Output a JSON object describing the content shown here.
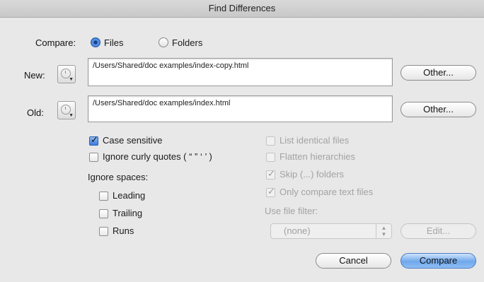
{
  "window": {
    "title": "Find Differences"
  },
  "compare": {
    "label": "Compare:",
    "options": [
      {
        "label": "Files",
        "selected": true
      },
      {
        "label": "Folders",
        "selected": false
      }
    ]
  },
  "new_file": {
    "label": "New:",
    "path": "/Users/Shared/doc examples/index-copy.html",
    "other_label": "Other..."
  },
  "old_file": {
    "label": "Old:",
    "path": "/Users/Shared/doc examples/index.html",
    "other_label": "Other..."
  },
  "options_left": {
    "case_sensitive": {
      "label": "Case sensitive",
      "checked": true
    },
    "ignore_curly_quotes": {
      "label": "Ignore curly quotes ( “ ” ‘ ’ )",
      "checked": false
    },
    "ignore_spaces_label": "Ignore spaces:",
    "spaces": [
      {
        "label": "Leading",
        "checked": false
      },
      {
        "label": "Trailing",
        "checked": false
      },
      {
        "label": "Runs",
        "checked": false
      }
    ]
  },
  "options_right": {
    "list_identical": {
      "label": "List identical files",
      "checked": false,
      "enabled": false
    },
    "flatten": {
      "label": "Flatten hierarchies",
      "checked": false,
      "enabled": false
    },
    "skip_folders": {
      "label": "Skip (...) folders",
      "checked": true,
      "enabled": false
    },
    "only_text": {
      "label": "Only compare text files",
      "checked": true,
      "enabled": false
    },
    "file_filter_label": "Use file filter:",
    "file_filter_value": "(none)",
    "edit_label": "Edit..."
  },
  "buttons": {
    "cancel": "Cancel",
    "compare": "Compare"
  }
}
